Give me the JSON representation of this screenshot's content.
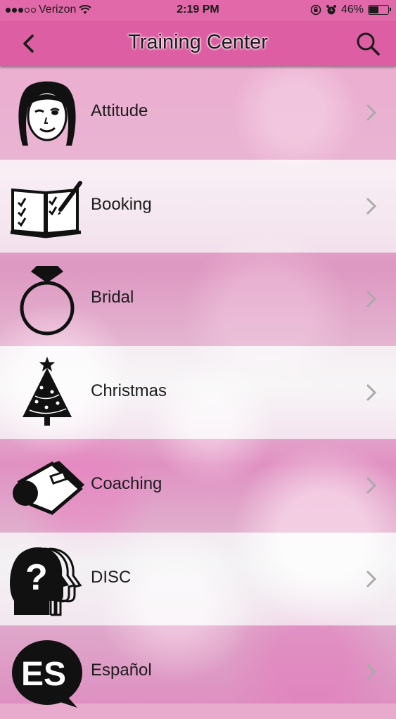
{
  "status_bar": {
    "carrier": "Verizon",
    "time": "2:19 PM",
    "battery": "46%",
    "battery_level": 0.46
  },
  "nav": {
    "title": "Training Center",
    "back_icon": "chevron-left-icon",
    "search_icon": "search-icon"
  },
  "items": [
    {
      "label": "Attitude",
      "icon": "winking-woman-icon"
    },
    {
      "label": "Booking",
      "icon": "open-book-checklist-icon"
    },
    {
      "label": "Bridal",
      "icon": "diamond-ring-icon"
    },
    {
      "label": "Christmas",
      "icon": "christmas-tree-icon"
    },
    {
      "label": "Coaching",
      "icon": "whistle-icon"
    },
    {
      "label": "DISC",
      "icon": "question-head-icon"
    },
    {
      "label": "Español",
      "icon": "es-speech-bubble-icon"
    }
  ],
  "colors": {
    "header": "#dd5ea3",
    "status_bar": "#e269a9",
    "chevron": "#aaaaaa"
  }
}
